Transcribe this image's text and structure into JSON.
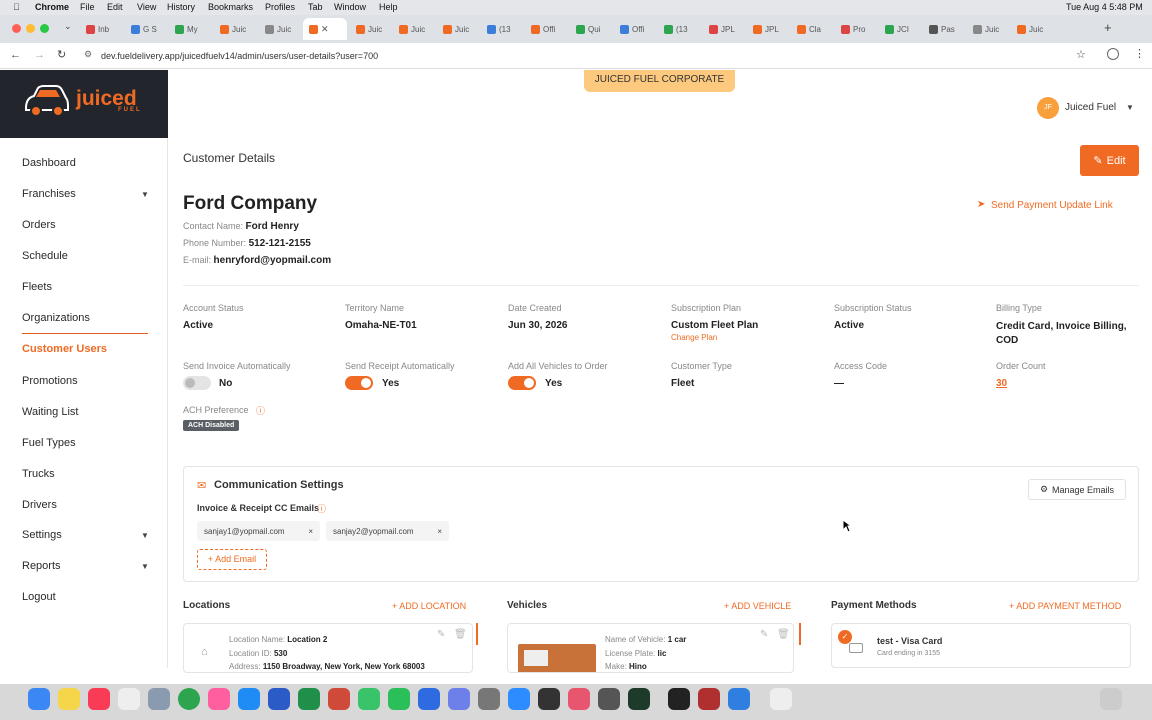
{
  "menubar": {
    "app": "Chrome",
    "items": [
      "File",
      "Edit",
      "View",
      "History",
      "Bookmarks",
      "Profiles",
      "Tab",
      "Window",
      "Help"
    ],
    "datetime": "Tue Aug 4  5:48 PM"
  },
  "tabs": [
    "Inb",
    "G S",
    "My",
    "Juic",
    "Juic",
    "Juic",
    "Juic",
    "Juic",
    "(13",
    "Offi",
    "Qui",
    "Offi",
    "(13",
    "JPL",
    "JPL",
    "Cla",
    "Pro",
    "JCI",
    "Pas",
    "Juic",
    "Juic"
  ],
  "browser": {
    "url": "dev.fueldelivery.app/juicedfuelv14/admin/users/user-details?user=700"
  },
  "brand": {
    "name": "juiced",
    "sub": "FUEL",
    "accent": "#f06a23"
  },
  "banner": "JUICED FUEL CORPORATE",
  "user_menu": {
    "initials": "JF",
    "name": "Juiced Fuel"
  },
  "sidebar": {
    "items": [
      {
        "label": "Dashboard"
      },
      {
        "label": "Franchises"
      },
      {
        "label": "Orders"
      },
      {
        "label": "Schedule"
      },
      {
        "label": "Fleets"
      },
      {
        "label": "Organizations"
      },
      {
        "label": "Customer Users"
      },
      {
        "label": "Promotions"
      },
      {
        "label": "Waiting List"
      },
      {
        "label": "Fuel Types"
      },
      {
        "label": "Trucks"
      },
      {
        "label": "Drivers"
      },
      {
        "label": "Settings"
      },
      {
        "label": "Reports"
      },
      {
        "label": "Logout"
      }
    ]
  },
  "page": {
    "title": "Customer Details",
    "edit_label": "Edit",
    "send_link_label": "Send Payment Update Link"
  },
  "customer": {
    "company": "Ford Company",
    "contact_label": "Contact Name:",
    "contact": "Ford Henry",
    "phone_label": "Phone Number:",
    "phone": "512-121-2155",
    "email_label": "E-mail:",
    "email": "henryford@yopmail.com"
  },
  "details": {
    "account_status": {
      "label": "Account Status",
      "value": "Active"
    },
    "territory": {
      "label": "Territory Name",
      "value": "Omaha-NE-T01"
    },
    "date_created": {
      "label": "Date Created",
      "value": "Jun 30, 2026"
    },
    "subscription_plan": {
      "label": "Subscription Plan",
      "value": "Custom Fleet Plan",
      "change": "Change Plan"
    },
    "subscription_status": {
      "label": "Subscription Status",
      "value": "Active"
    },
    "billing_type": {
      "label": "Billing Type",
      "value": "Credit Card, Invoice Billing, COD"
    },
    "send_invoice": {
      "label": "Send Invoice Automatically",
      "value": "No"
    },
    "send_receipt": {
      "label": "Send Receipt Automatically",
      "value": "Yes"
    },
    "add_vehicles": {
      "label": "Add All Vehicles to Order",
      "value": "Yes"
    },
    "customer_type": {
      "label": "Customer Type",
      "value": "Fleet"
    },
    "access_code": {
      "label": "Access Code",
      "value": "—"
    },
    "order_count": {
      "label": "Order Count",
      "value": "30"
    },
    "ach": {
      "label": "ACH Preference",
      "badge": "ACH Disabled"
    }
  },
  "communication": {
    "title": "Communication Settings",
    "manage_label": "Manage Emails",
    "cc_label": "Invoice & Receipt CC Emails",
    "emails": [
      "sanjay1@yopmail.com",
      "sanjay2@yopmail.com"
    ],
    "add_label": "+ Add Email"
  },
  "locations": {
    "title": "Locations",
    "add_label": "+ ADD LOCATION",
    "name_label": "Location Name:",
    "name": "Location 2",
    "id_label": "Location ID:",
    "id": "530",
    "addr_label": "Address:",
    "addr": "1150 Broadway, New York, New York 68003"
  },
  "vehicles": {
    "title": "Vehicles",
    "add_label": "+ ADD VEHICLE",
    "name_label": "Name of Vehicle:",
    "name": "1 car",
    "plate_label": "License Plate:",
    "plate": "lic",
    "make_label": "Make:",
    "make": "Hino"
  },
  "payments": {
    "title": "Payment Methods",
    "add_label": "+ ADD PAYMENT METHOD",
    "card_name": "test - Visa Card",
    "card_sub": "Card ending in 3155"
  }
}
